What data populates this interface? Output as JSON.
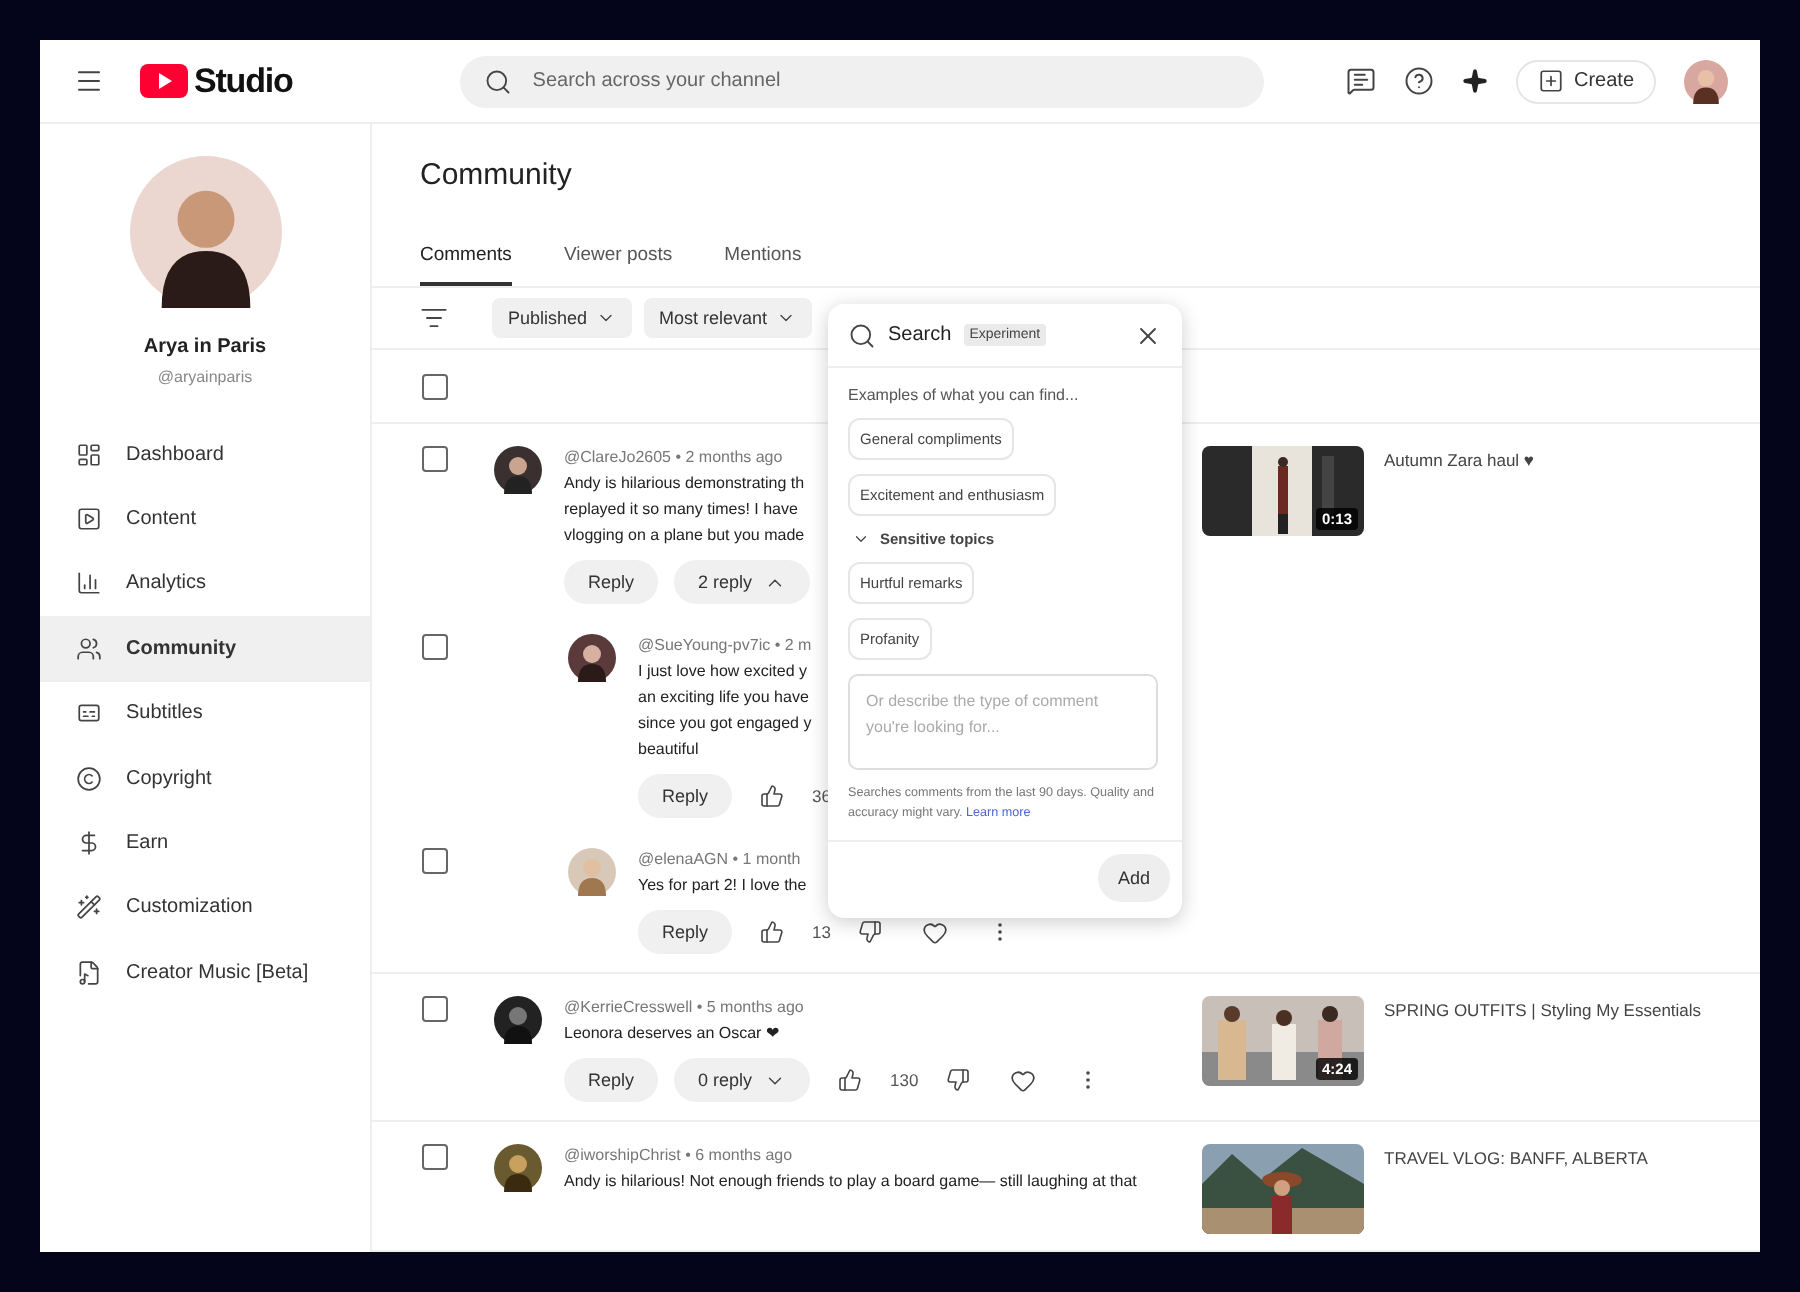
{
  "topbar": {
    "logo": "Studio",
    "search_placeholder": "Search across your channel",
    "create": "Create"
  },
  "channel": {
    "name": "Arya in Paris",
    "handle": "@aryainparis"
  },
  "sidebar": {
    "items": [
      {
        "kind": "dashboard",
        "label": "Dashboard",
        "selected": false
      },
      {
        "kind": "content",
        "label": "Content",
        "selected": false
      },
      {
        "kind": "analytics",
        "label": "Analytics",
        "selected": false
      },
      {
        "kind": "community",
        "label": "Community",
        "selected": true
      },
      {
        "kind": "subtitles",
        "label": "Subtitles",
        "selected": false
      },
      {
        "kind": "copyright",
        "label": "Copyright",
        "selected": false
      },
      {
        "kind": "earn",
        "label": "Earn",
        "selected": false
      },
      {
        "kind": "customization",
        "label": "Customization",
        "selected": false
      },
      {
        "kind": "music",
        "label": "Creator Music [Beta]",
        "selected": false
      }
    ]
  },
  "page": {
    "title": "Community"
  },
  "tabs": [
    {
      "label": "Comments",
      "selected": true
    },
    {
      "label": "Viewer posts",
      "selected": false
    },
    {
      "label": "Mentions",
      "selected": false
    }
  ],
  "filters": [
    "Published",
    "Most relevant"
  ],
  "select_all": {
    "checked": false
  },
  "comments": [
    {
      "checked": false,
      "meta": "@ClareJo2605 • 2 months ago",
      "lines": [
        "Andy is hilarious demonstrating th",
        "replayed it so many times! I have",
        "vlogging on a plane but you made"
      ],
      "actions": [
        {
          "kind": "reply",
          "label": "Reply"
        },
        {
          "kind": "toggle",
          "label": "2 reply",
          "expanded": true
        }
      ],
      "video": {
        "title": "Autumn Zara haul ♥",
        "duration": "0:13"
      },
      "children": [
        {
          "checked": false,
          "meta": "@SueYoung-pv7ic • 2 m",
          "lines": [
            "I just love how excited y",
            "an exciting life you have",
            "since you got engaged y",
            "beautiful"
          ],
          "actions": [
            {
              "kind": "reply",
              "label": "Reply"
            },
            {
              "kind": "like",
              "count": "36"
            }
          ]
        },
        {
          "checked": false,
          "meta": "@elenaAGN • 1 month",
          "lines": [
            "Yes for part 2! I love the"
          ],
          "actions": [
            {
              "kind": "reply",
              "label": "Reply"
            },
            {
              "kind": "like",
              "count": "13"
            },
            {
              "kind": "dislike"
            },
            {
              "kind": "heart"
            },
            {
              "kind": "more"
            }
          ]
        }
      ]
    },
    {
      "checked": false,
      "meta": "@KerrieCresswell • 5 months ago",
      "lines": [
        "Leonora deserves an Oscar ❤"
      ],
      "actions": [
        {
          "kind": "reply",
          "label": "Reply"
        },
        {
          "kind": "toggle",
          "label": "0 reply",
          "expanded": false
        },
        {
          "kind": "like",
          "count": "130"
        },
        {
          "kind": "dislike"
        },
        {
          "kind": "heart"
        },
        {
          "kind": "more"
        }
      ],
      "video": {
        "title": "SPRING OUTFITS | Styling My Essentials",
        "duration": "4:24"
      }
    },
    {
      "checked": false,
      "meta": "@iworshipChrist • 6 months ago",
      "lines": [
        "Andy is hilarious! Not enough friends to play a board game— still laughing at that"
      ],
      "video": {
        "title": "TRAVEL VLOG: BANFF, ALBERTA"
      }
    }
  ],
  "popup": {
    "title": "Search",
    "badge": "Experiment",
    "intro": "Examples of what you can find...",
    "chips": [
      "General compliments",
      "Excitement and enthusiasm"
    ],
    "section": {
      "label": "Sensitive topics",
      "expanded": true,
      "chips": [
        "Hurtful remarks",
        "Profanity"
      ]
    },
    "placeholder": "Or describe the type of comment you're looking for...",
    "note": "Searches comments from the last 90 days. Quality and accuracy might vary.",
    "link": "Learn more",
    "button": "Add"
  }
}
